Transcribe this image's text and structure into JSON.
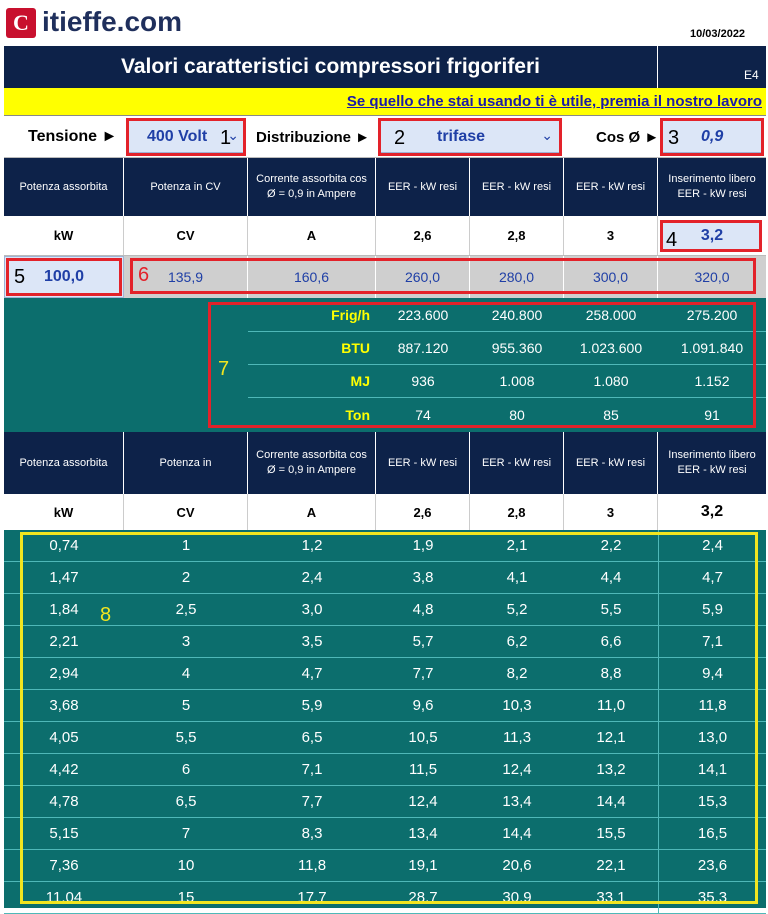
{
  "brand": {
    "name": "itieffe.com",
    "logo_glyph": "C"
  },
  "date": "10/03/2022",
  "title": "Valori caratteristici compressori frigoriferi",
  "code": "E4",
  "banner_link": "Se quello che stai usando ti è utile, premia il nostro lavoro",
  "controls": {
    "tensione_label": "Tensione ►",
    "tensione_value": "400 Volt",
    "distribuzione_label": "Distribuzione ►",
    "distribuzione_value": "trifase",
    "cos_label": "Cos Ø ►",
    "cos_value": "0,9"
  },
  "header1": [
    "Potenza assorbita",
    "Potenza in CV",
    "Corrente assorbita cos Ø = 0,9 in Ampere",
    "EER - kW resi",
    "EER - kW resi",
    "EER - kW resi",
    "Inserimento libero EER - kW resi"
  ],
  "units1": [
    "kW",
    "CV",
    "A",
    "2,6",
    "2,8",
    "3",
    "3,2"
  ],
  "calc_row": [
    "100,0",
    "135,9",
    "160,6",
    "260,0",
    "280,0",
    "300,0",
    "320,0"
  ],
  "conversions": [
    {
      "label": "Frig/h",
      "values": [
        "223.600",
        "240.800",
        "258.000",
        "275.200"
      ]
    },
    {
      "label": "BTU",
      "values": [
        "887.120",
        "955.360",
        "1.023.600",
        "1.091.840"
      ]
    },
    {
      "label": "MJ",
      "values": [
        "936",
        "1.008",
        "1.080",
        "1.152"
      ]
    },
    {
      "label": "Ton",
      "values": [
        "74",
        "80",
        "85",
        "91"
      ]
    }
  ],
  "header2": [
    "Potenza assorbita",
    "Potenza in",
    "Corrente assorbita cos Ø = 0,9 in Ampere",
    "EER - kW resi",
    "EER - kW resi",
    "EER - kW resi",
    "Inserimento libero EER - kW resi"
  ],
  "units2": [
    "kW",
    "CV",
    "A",
    "2,6",
    "2,8",
    "3",
    "3,2"
  ],
  "table_rows": [
    [
      "0,74",
      "1",
      "1,2",
      "1,9",
      "2,1",
      "2,2",
      "2,4"
    ],
    [
      "1,47",
      "2",
      "2,4",
      "3,8",
      "4,1",
      "4,4",
      "4,7"
    ],
    [
      "1,84",
      "2,5",
      "3,0",
      "4,8",
      "5,2",
      "5,5",
      "5,9"
    ],
    [
      "2,21",
      "3",
      "3,5",
      "5,7",
      "6,2",
      "6,6",
      "7,1"
    ],
    [
      "2,94",
      "4",
      "4,7",
      "7,7",
      "8,2",
      "8,8",
      "9,4"
    ],
    [
      "3,68",
      "5",
      "5,9",
      "9,6",
      "10,3",
      "11,0",
      "11,8"
    ],
    [
      "4,05",
      "5,5",
      "6,5",
      "10,5",
      "11,3",
      "12,1",
      "13,0"
    ],
    [
      "4,42",
      "6",
      "7,1",
      "11,5",
      "12,4",
      "13,2",
      "14,1"
    ],
    [
      "4,78",
      "6,5",
      "7,7",
      "12,4",
      "13,4",
      "14,4",
      "15,3"
    ],
    [
      "5,15",
      "7",
      "8,3",
      "13,4",
      "14,4",
      "15,5",
      "16,5"
    ],
    [
      "7,36",
      "10",
      "11,8",
      "19,1",
      "20,6",
      "22,1",
      "23,6"
    ],
    [
      "11,04",
      "15",
      "17,7",
      "28,7",
      "30,9",
      "33,1",
      "35,3"
    ]
  ],
  "annotations": [
    "1",
    "2",
    "3",
    "4",
    "5",
    "6",
    "7",
    "8"
  ],
  "colors": {
    "navy": "#0d2249",
    "teal": "#0c6e6d",
    "banner_yellow": "#ffff00",
    "input_blue": "#dce6f7",
    "red_marker": "#e3222a",
    "yellow_marker": "#f2e51f"
  }
}
